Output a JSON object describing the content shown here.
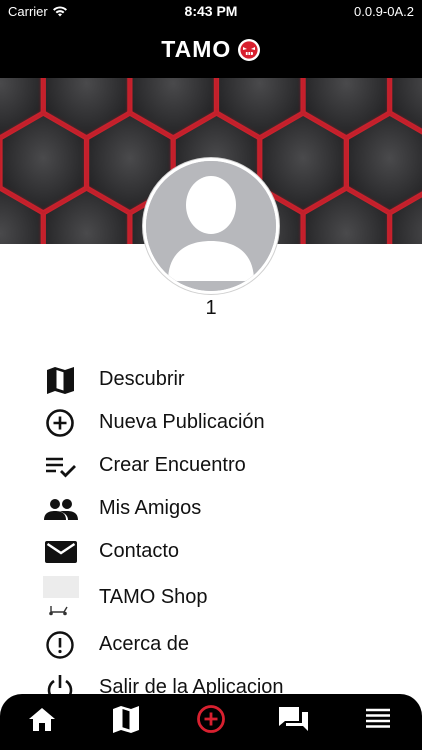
{
  "status_bar": {
    "carrier": "Carrier",
    "time": "8:43 PM",
    "version": "0.0.9-0A.2"
  },
  "header": {
    "logo_text": "TAMO"
  },
  "profile": {
    "username": "1"
  },
  "menu": {
    "items": [
      {
        "label": "Descubrir",
        "icon": "map-icon"
      },
      {
        "label": "Nueva Publicación",
        "icon": "add-circle-icon"
      },
      {
        "label": "Crear Encuentro",
        "icon": "playlist-check-icon"
      },
      {
        "label": "Mis Amigos",
        "icon": "people-icon"
      },
      {
        "label": "Contacto",
        "icon": "mail-icon"
      },
      {
        "label": "TAMO Shop",
        "icon": "scooter-icon"
      },
      {
        "label": "Acerca de",
        "icon": "info-circle-icon"
      },
      {
        "label": "Salir de la Aplicacion",
        "icon": "power-icon"
      }
    ]
  },
  "tab_bar": {
    "tabs": [
      {
        "icon": "home-icon"
      },
      {
        "icon": "map-icon"
      },
      {
        "icon": "add-circle-icon",
        "active": true
      },
      {
        "icon": "chat-icon"
      },
      {
        "icon": "menu-icon"
      }
    ]
  },
  "colors": {
    "accent": "#d8202f",
    "bar_background": "#000000",
    "avatar_placeholder": "#b7b8bc"
  }
}
